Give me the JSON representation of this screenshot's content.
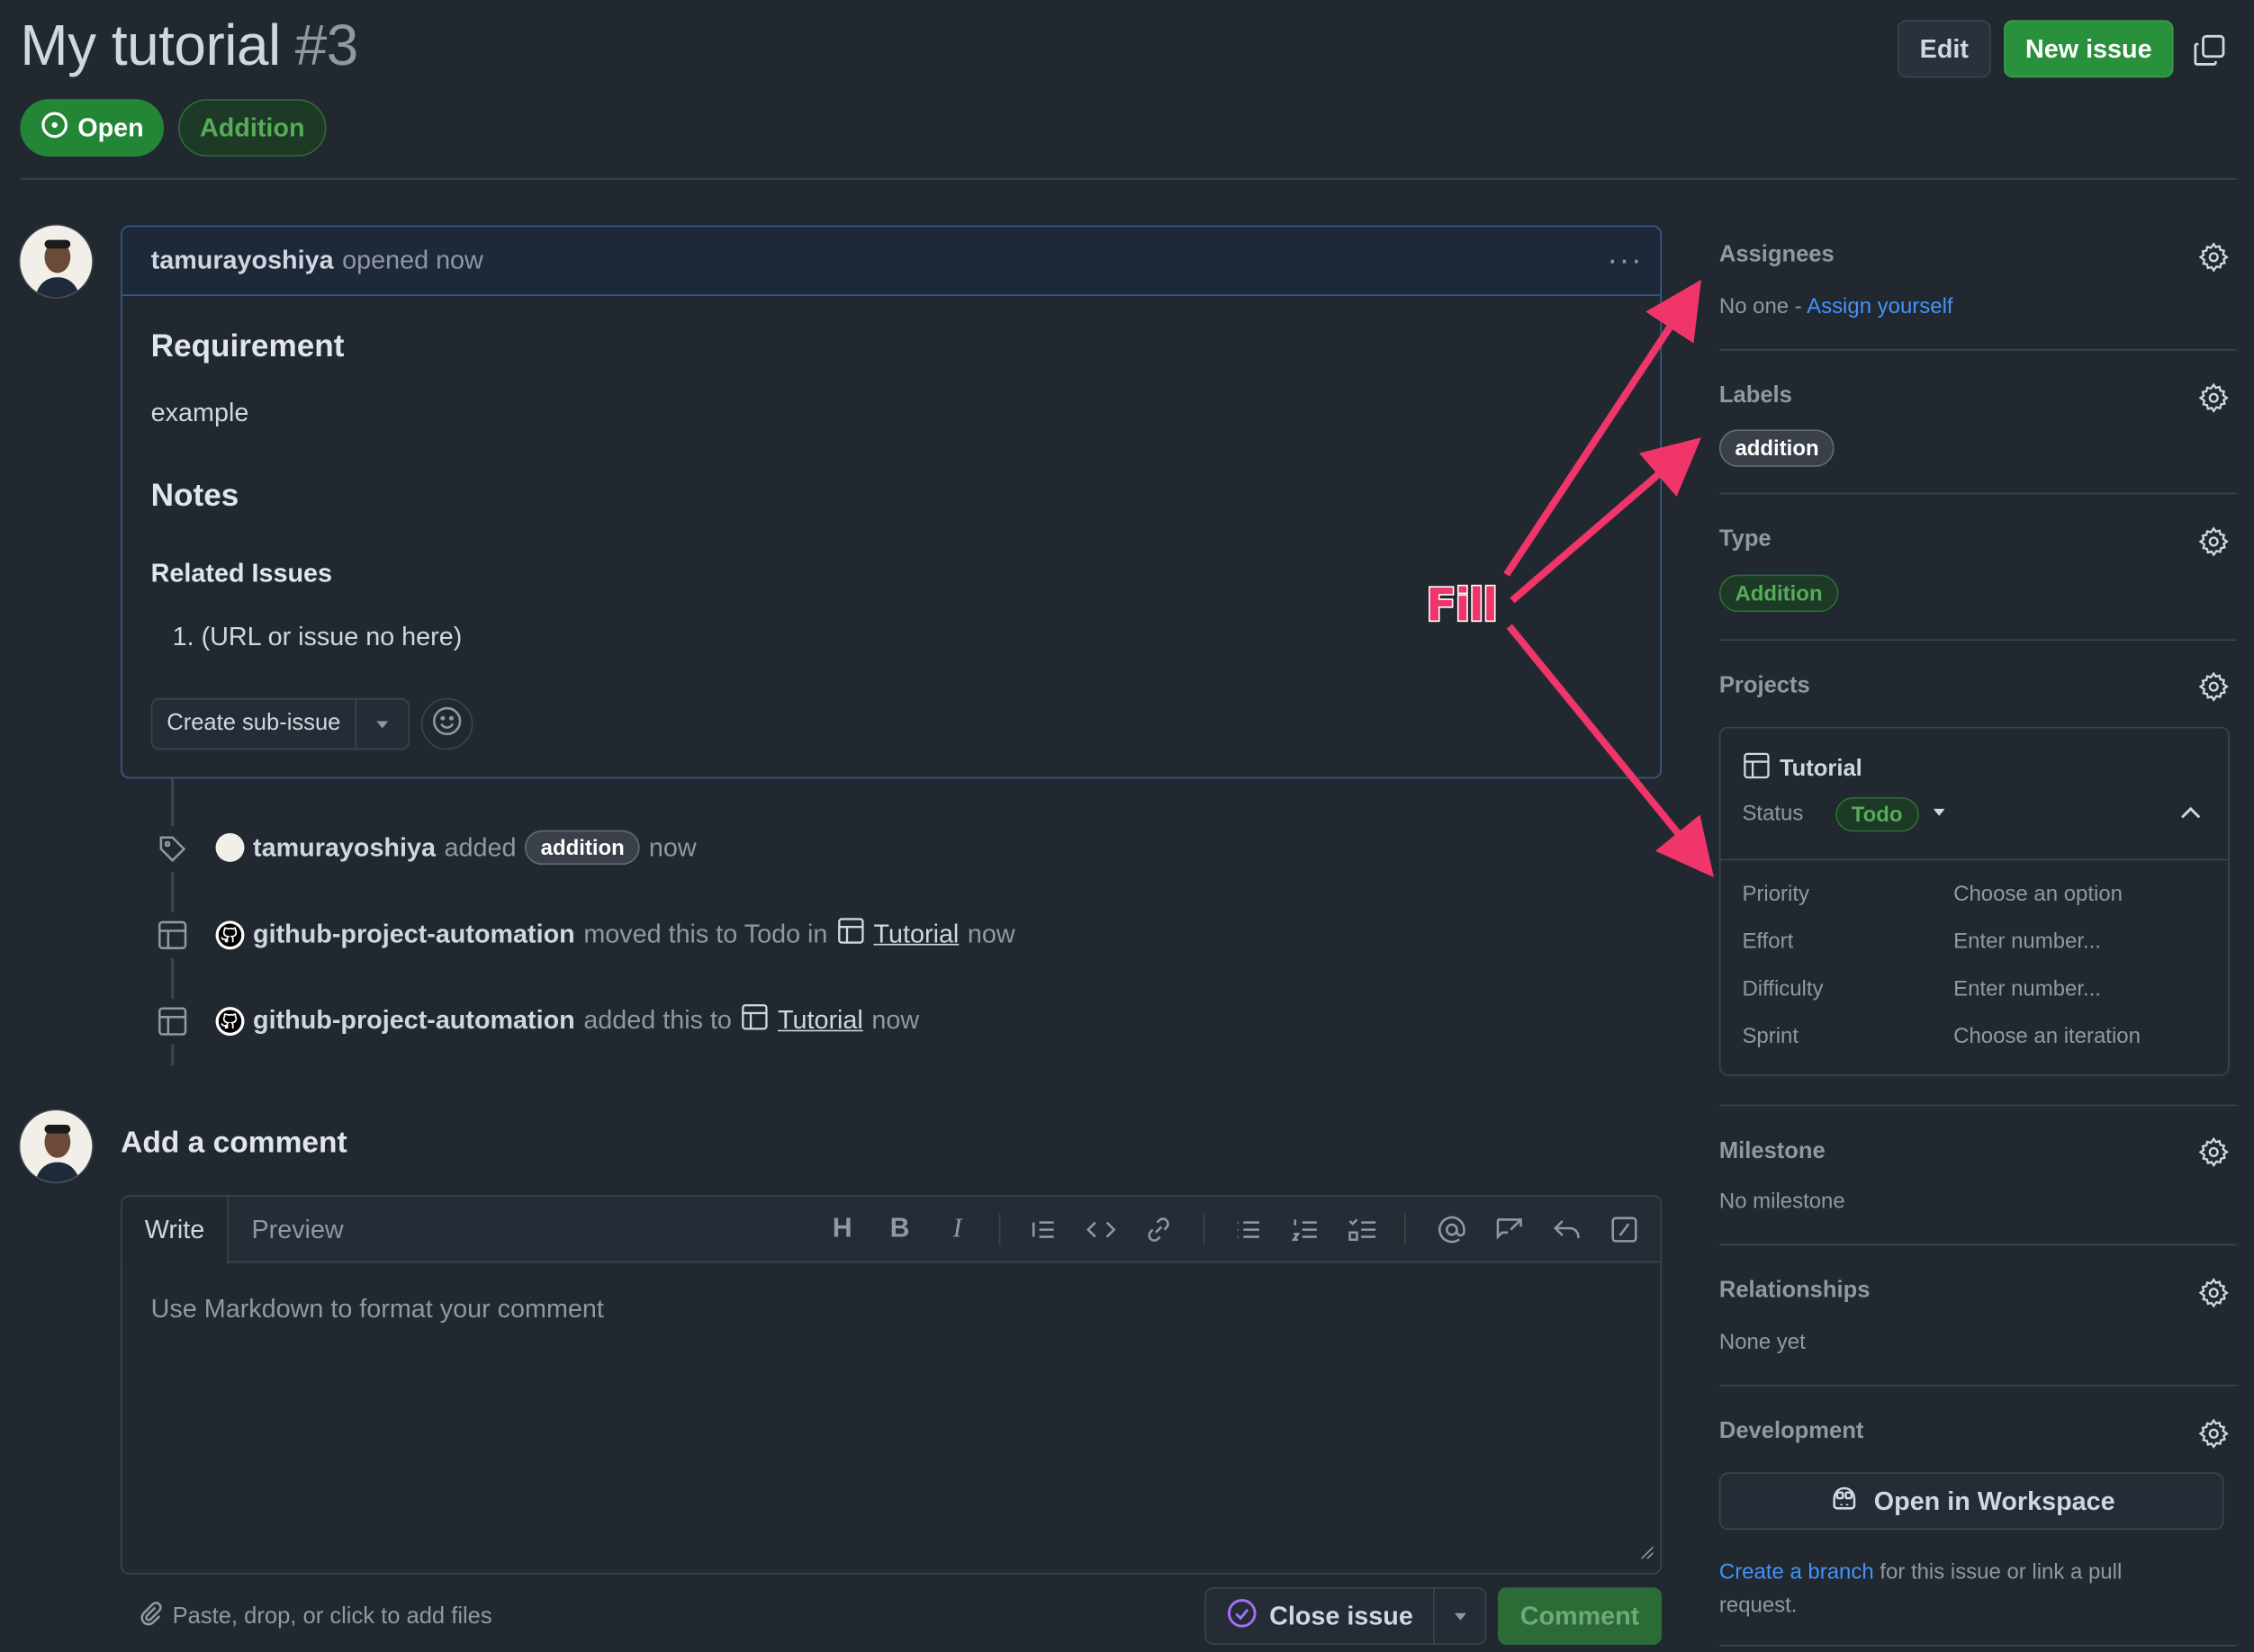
{
  "issue": {
    "title": "My tutorial",
    "number": "#3",
    "state": "Open",
    "type_pill": "Addition"
  },
  "header": {
    "edit_label": "Edit",
    "new_issue_label": "New issue"
  },
  "comment": {
    "author": "tamurayoshiya",
    "action": "opened now",
    "h_requirement": "Requirement",
    "requirement_text": "example",
    "h_notes": "Notes",
    "h_related": "Related Issues",
    "related_item": "1. (URL or issue no here)",
    "create_sub_issue": "Create sub-issue"
  },
  "timeline": [
    {
      "actor": "tamurayoshiya",
      "verb": "added",
      "label": "addition",
      "time": "now"
    },
    {
      "actor": "github-project-automation",
      "verb": "moved this to Todo in",
      "project": "Tutorial",
      "time": "now"
    },
    {
      "actor": "github-project-automation",
      "verb": "added this to",
      "project": "Tutorial",
      "time": "now"
    }
  ],
  "add_comment": {
    "title": "Add a comment",
    "tab_write": "Write",
    "tab_preview": "Preview",
    "placeholder": "Use Markdown to format your comment",
    "paste_hint": "Paste, drop, or click to add files",
    "close_issue": "Close issue",
    "comment_button": "Comment",
    "toolbar": [
      "H",
      "B",
      "I"
    ]
  },
  "sidebar": {
    "assignees": {
      "heading": "Assignees",
      "none": "No one -",
      "assign_self": "Assign yourself"
    },
    "labels": {
      "heading": "Labels",
      "label": "addition"
    },
    "type": {
      "heading": "Type",
      "value": "Addition"
    },
    "projects": {
      "heading": "Projects",
      "project_name": "Tutorial",
      "status_label": "Status",
      "status_value": "Todo",
      "fields": [
        {
          "name": "Priority",
          "value": "Choose an option"
        },
        {
          "name": "Effort",
          "value": "Enter number..."
        },
        {
          "name": "Difficulty",
          "value": "Enter number..."
        },
        {
          "name": "Sprint",
          "value": "Choose an iteration"
        }
      ]
    },
    "milestone": {
      "heading": "Milestone",
      "value": "No milestone"
    },
    "relationships": {
      "heading": "Relationships",
      "value": "None yet"
    },
    "development": {
      "heading": "Development",
      "workspace_button": "Open in Workspace",
      "create_branch": "Create a branch",
      "branch_text_1": "for this issue or link a pull",
      "branch_text_2": "request."
    }
  },
  "annotation": {
    "text": "Fill",
    "color": "#f0356b"
  },
  "colors": {
    "bg": "#212830",
    "green": "#238636",
    "link": "#4493f8",
    "border": "#3d444d"
  }
}
